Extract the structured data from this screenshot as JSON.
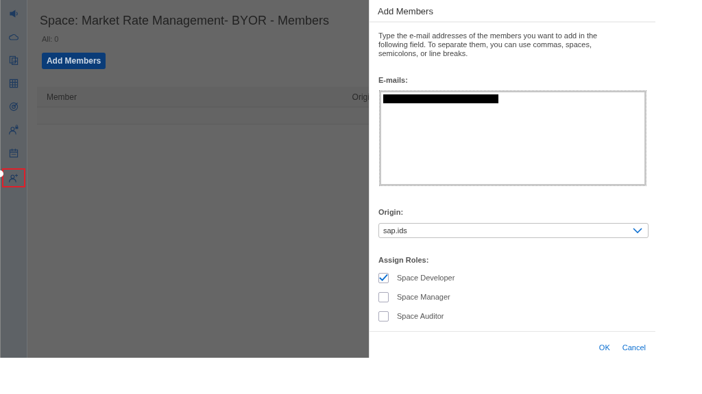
{
  "sidebar": {
    "items": [
      {
        "kind": "logo",
        "selected": false
      },
      {
        "kind": "cloud",
        "selected": false
      },
      {
        "kind": "transfer",
        "selected": false
      },
      {
        "kind": "grid",
        "selected": false
      },
      {
        "kind": "target",
        "selected": false
      },
      {
        "kind": "lock",
        "selected": false
      },
      {
        "kind": "calendar",
        "selected": false
      },
      {
        "kind": "adduser",
        "selected": true
      }
    ]
  },
  "page": {
    "title": "Space: Market Rate Management- BYOR - Members",
    "count": "All: 0",
    "add_button": "Add Members",
    "table": {
      "columns": [
        "Member",
        "Origi"
      ]
    }
  },
  "dialog": {
    "title": "Add Members",
    "description": "Type the e-mail addresses of the members you want to add in the following field. To separate them, you can use commas, spaces, semicolons, or line breaks.",
    "emails_label": "E-mails:",
    "emails_redacted": true,
    "origin_label": "Origin:",
    "origin_value": "sap.ids",
    "roles_label": "Assign Roles:",
    "roles": [
      {
        "label": "Space Developer",
        "checked": true
      },
      {
        "label": "Space Manager",
        "checked": false
      },
      {
        "label": "Space Auditor",
        "checked": false
      }
    ],
    "buttons": [
      {
        "label": "OK"
      },
      {
        "label": "Cancel"
      }
    ]
  }
}
